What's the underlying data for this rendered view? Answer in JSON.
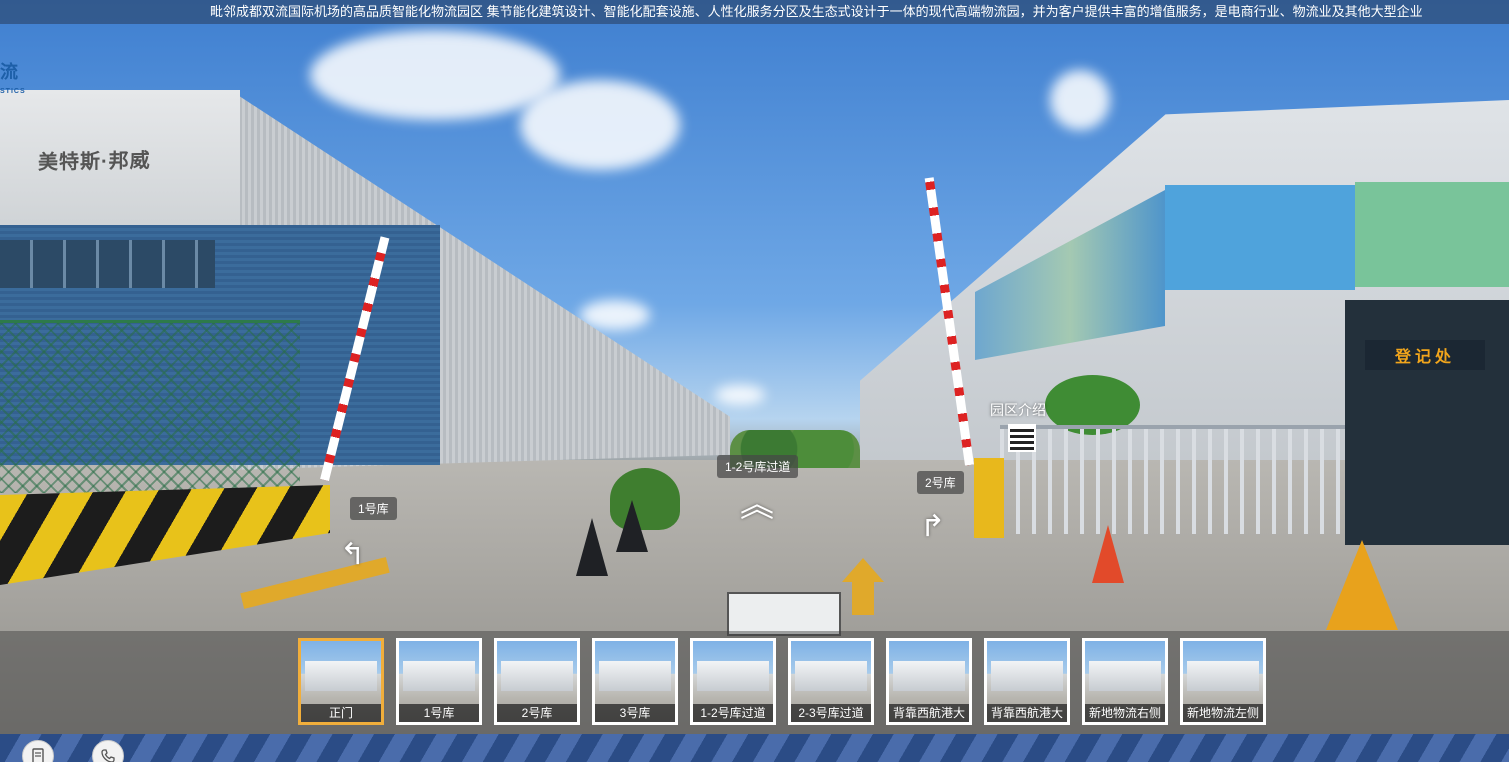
{
  "marquee": {
    "text": "毗邻成都双流国际机场的高品质智能化物流园区 集节能化建筑设计、智能化配套设施、人性化服务分区及生态式设计于一体的现代高端物流园，并为客户提供丰富的增值服务，是电商行业、物流业及其他大型企业"
  },
  "logo": {
    "text": "流",
    "sub": "STICS"
  },
  "scene": {
    "building_name": "美特斯·邦威",
    "guardhouse_sign": "登记处"
  },
  "hotspots": {
    "warehouse1": "1号库",
    "passage12": "1-2号库过道",
    "warehouse2": "2号库",
    "park_intro": "园区介绍"
  },
  "thumbnails": [
    {
      "label": "正门",
      "active": true
    },
    {
      "label": "1号库",
      "active": false
    },
    {
      "label": "2号库",
      "active": false
    },
    {
      "label": "3号库",
      "active": false
    },
    {
      "label": "1-2号库过道",
      "active": false
    },
    {
      "label": "2-3号库过道",
      "active": false
    },
    {
      "label": "背靠西航港大",
      "active": false
    },
    {
      "label": "背靠西航港大",
      "active": false
    },
    {
      "label": "新地物流右侧",
      "active": false
    },
    {
      "label": "新地物流左侧",
      "active": false
    }
  ],
  "buttons": {
    "menu_icon": "document-icon",
    "phone_icon": "phone-icon"
  },
  "colors": {
    "active_thumb_border": "#f1ae3b",
    "accent_blue": "#1d5fa8"
  }
}
